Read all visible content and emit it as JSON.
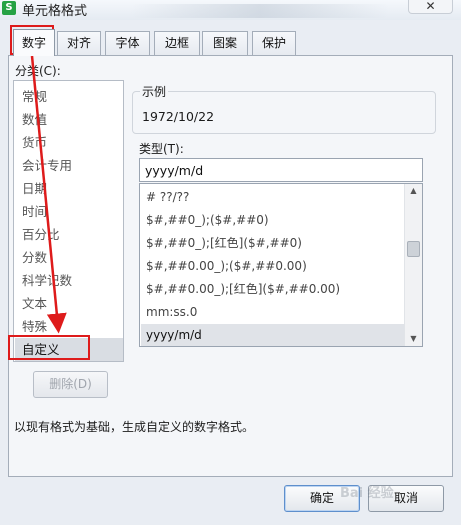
{
  "window": {
    "title": "单元格格式",
    "app_icon_glyph": "S",
    "close_glyph": "✕"
  },
  "tabs": [
    {
      "label": "数字",
      "active": true
    },
    {
      "label": "对齐"
    },
    {
      "label": "字体"
    },
    {
      "label": "边框"
    },
    {
      "label": "图案"
    },
    {
      "label": "保护"
    }
  ],
  "category": {
    "label": "分类(C):",
    "items": [
      "常规",
      "数值",
      "货币",
      "会计专用",
      "日期",
      "时间",
      "百分比",
      "分数",
      "科学记数",
      "文本",
      "特殊",
      "自定义"
    ],
    "selected": "自定义"
  },
  "delete_button": "删除(D)",
  "example": {
    "label": "示例",
    "value": "1972/10/22"
  },
  "type": {
    "label": "类型(T):",
    "value": "yyyy/m/d",
    "options": [
      "# ??/??",
      "$#,##0_);($#,##0)",
      "$#,##0_);[红色]($#,##0)",
      "$#,##0.00_);($#,##0.00)",
      "$#,##0.00_);[红色]($#,##0.00)",
      "mm:ss.0",
      "yyyy/m/d"
    ],
    "selected": "yyyy/m/d"
  },
  "description": "以现有格式为基础，生成自定义的数字格式。",
  "buttons": {
    "ok": "确定",
    "cancel": "取消"
  },
  "watermark": "Bai 经验",
  "annotation_color": "#de1b1b"
}
